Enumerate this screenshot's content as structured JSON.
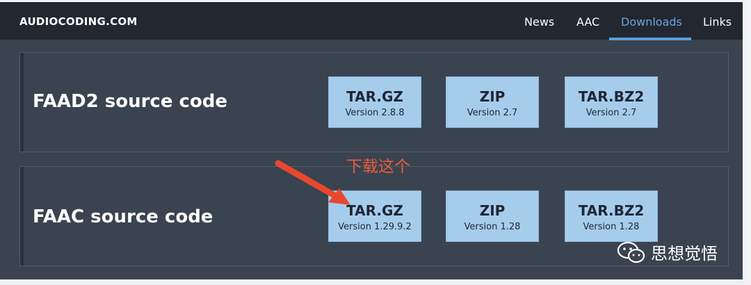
{
  "header": {
    "brand": "AUDIOCODING.COM",
    "nav": [
      "News",
      "AAC",
      "Downloads",
      "Links"
    ],
    "active_nav": "Downloads",
    "active_color": "#6aa6df"
  },
  "sections": [
    {
      "title": "FAAD2 source code",
      "downloads": [
        {
          "format": "TAR.GZ",
          "version": "Version 2.8.8"
        },
        {
          "format": "ZIP",
          "version": "Version 2.7"
        },
        {
          "format": "TAR.BZ2",
          "version": "Version 2.7"
        }
      ]
    },
    {
      "title": "FAAC source code",
      "downloads": [
        {
          "format": "TAR.GZ",
          "version": "Version 1.29.9.2"
        },
        {
          "format": "ZIP",
          "version": "Version 1.28"
        },
        {
          "format": "TAR.BZ2",
          "version": "Version 1.28"
        }
      ]
    }
  ],
  "annotation": {
    "text": "下载这个",
    "color": "#e85c3a",
    "icon": "arrow-icon"
  },
  "watermark": {
    "text": "思想觉悟",
    "icon": "wechat-icon"
  },
  "colors": {
    "page_bg": "#3a4350",
    "topbar_bg": "#23272f",
    "button_bg": "#a6ccec"
  }
}
